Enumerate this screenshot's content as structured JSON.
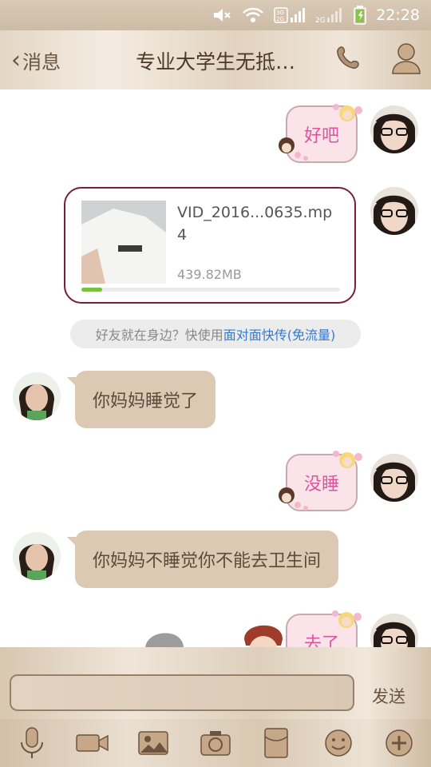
{
  "status_bar": {
    "time": "22:28",
    "network_label": "3G 2G",
    "network_label2": "2G"
  },
  "header": {
    "back_label": "消息",
    "title": "专业大学生无抵…"
  },
  "messages": {
    "out1": "好吧",
    "video": {
      "name": "VID_2016...0635.mp4",
      "size": "439.82MB",
      "progress": 0.08
    },
    "tip": {
      "text": "好友就在身边？快使用",
      "link": "面对面快传(免流量)"
    },
    "in1": "你妈妈睡觉了",
    "out2": "没睡",
    "in2": "你妈妈不睡觉你不能去卫生间",
    "out3": "去了"
  },
  "composer": {
    "input_value": "",
    "send_label": "发送"
  },
  "toolbar": [
    "voice-icon",
    "video-call-icon",
    "photo-icon",
    "camera-icon",
    "hongbao-icon",
    "emoji-icon",
    "plus-icon"
  ],
  "colors": {
    "accent_pink": "#e0539c",
    "in_bubble": "#dcc9b4",
    "link": "#2e7ad6"
  }
}
